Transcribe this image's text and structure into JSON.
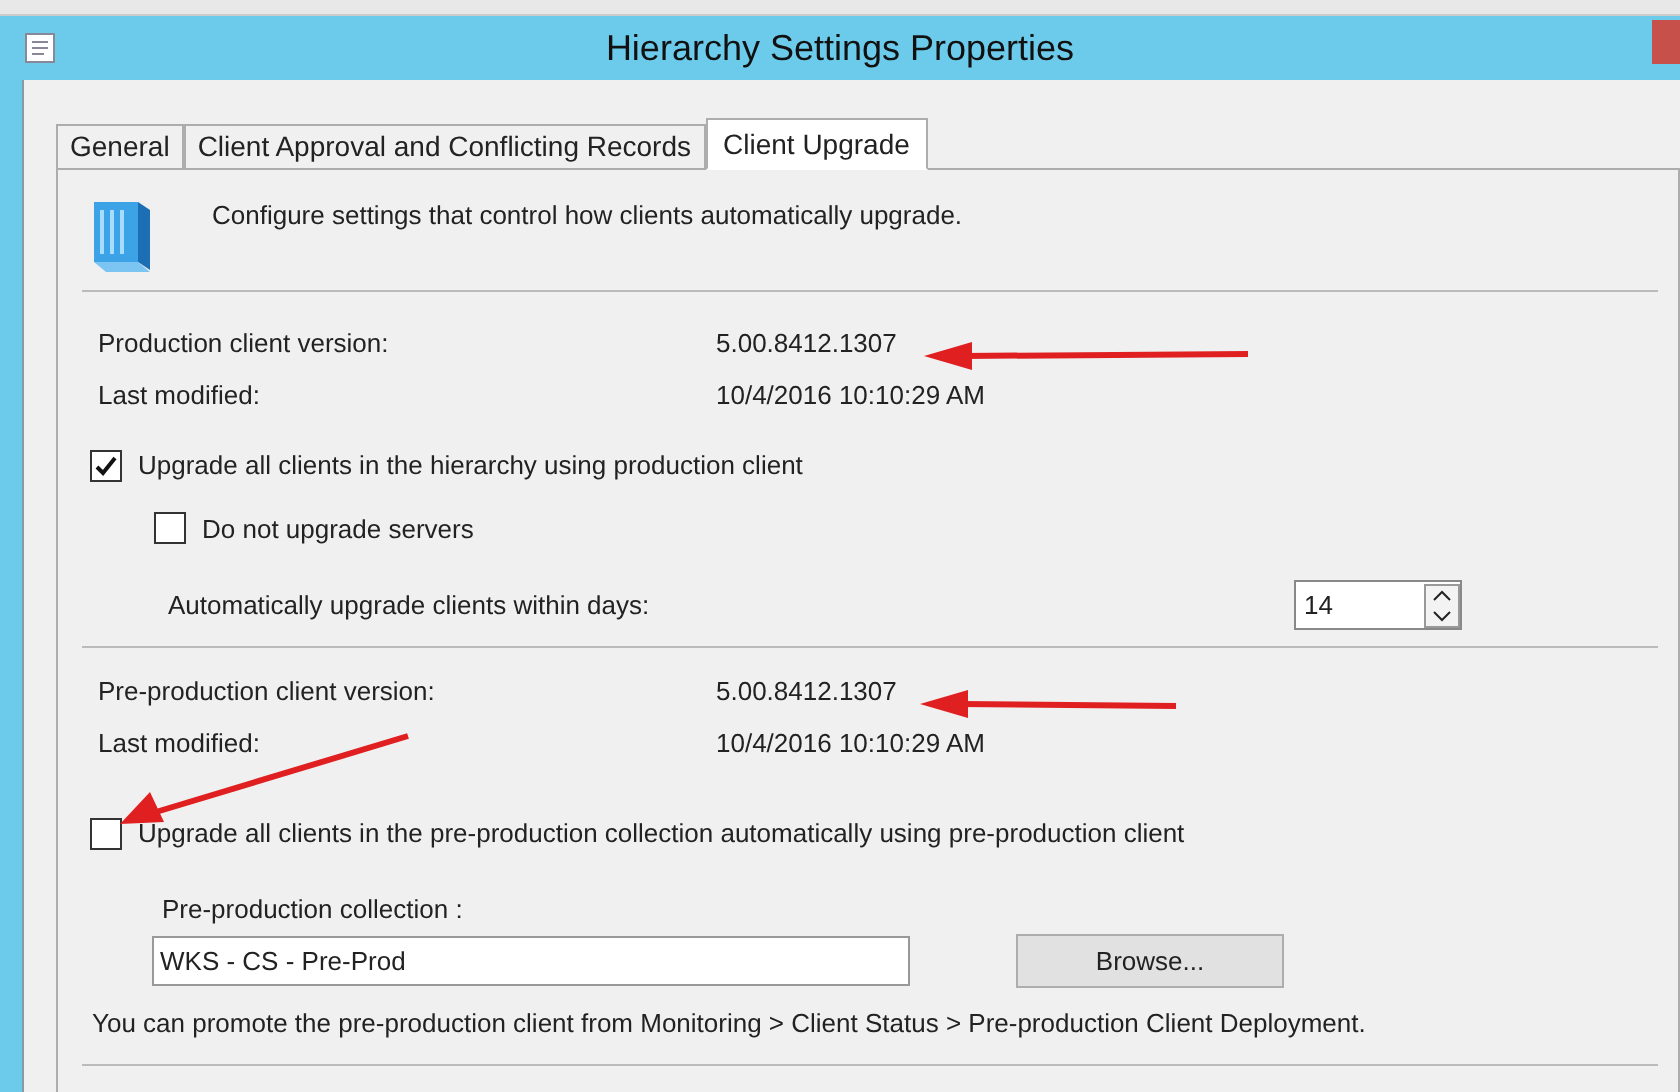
{
  "window": {
    "title": "Hierarchy Settings Properties"
  },
  "tabs": [
    {
      "label": "General",
      "selected": false
    },
    {
      "label": "Client Approval and Conflicting Records",
      "selected": false
    },
    {
      "label": "Client Upgrade",
      "selected": true
    }
  ],
  "intro": "Configure settings that control how clients automatically upgrade.",
  "production": {
    "version_label": "Production client version:",
    "version": "5.00.8412.1307",
    "modified_label": "Last modified:",
    "modified": "10/4/2016 10:10:29 AM",
    "upgrade": {
      "label": "Upgrade all clients in the hierarchy using production client",
      "checked": true
    },
    "no_servers": {
      "label": "Do not upgrade servers",
      "checked": false
    },
    "days_label": "Automatically upgrade clients within days:",
    "days": "14"
  },
  "preproduction": {
    "version_label": "Pre-production client version:",
    "version": "5.00.8412.1307",
    "modified_label": "Last modified:",
    "modified": "10/4/2016 10:10:29 AM",
    "upgrade": {
      "label": "Upgrade all clients in the pre-production collection automatically using pre-production client",
      "checked": false
    },
    "collection_label": "Pre-production collection :",
    "collection": "WKS - CS - Pre-Prod",
    "browse": "Browse...",
    "note": "You can promote the pre-production client from Monitoring > Client Status > Pre-production Client Deployment."
  }
}
